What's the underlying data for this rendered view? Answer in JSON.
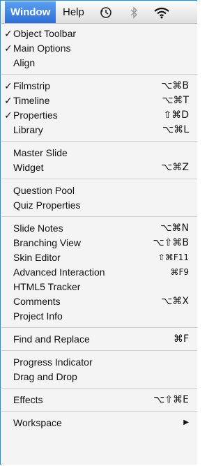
{
  "menubar": {
    "window": "Window",
    "help": "Help"
  },
  "groups": [
    [
      {
        "label": "Object Toolbar",
        "checked": true,
        "shortcut": ""
      },
      {
        "label": "Main Options",
        "checked": true,
        "shortcut": ""
      },
      {
        "label": "Align",
        "checked": false,
        "shortcut": ""
      }
    ],
    [
      {
        "label": "Filmstrip",
        "checked": true,
        "shortcut": "⌥⌘B"
      },
      {
        "label": "Timeline",
        "checked": true,
        "shortcut": "⌥⌘T"
      },
      {
        "label": "Properties",
        "checked": true,
        "shortcut": "⇧⌘D"
      },
      {
        "label": "Library",
        "checked": false,
        "shortcut": "⌥⌘L"
      }
    ],
    [
      {
        "label": "Master Slide",
        "checked": false,
        "shortcut": ""
      },
      {
        "label": "Widget",
        "checked": false,
        "shortcut": "⌥⌘Z"
      }
    ],
    [
      {
        "label": "Question Pool",
        "checked": false,
        "shortcut": ""
      },
      {
        "label": "Quiz Properties",
        "checked": false,
        "shortcut": ""
      }
    ],
    [
      {
        "label": "Slide Notes",
        "checked": false,
        "shortcut": "⌥⌘N"
      },
      {
        "label": "Branching View",
        "checked": false,
        "shortcut": "⌥⇧⌘B"
      },
      {
        "label": "Skin Editor",
        "checked": false,
        "shortcut": "⇧⌘F11"
      },
      {
        "label": "Advanced Interaction",
        "checked": false,
        "shortcut": "⌘F9"
      },
      {
        "label": "HTML5 Tracker",
        "checked": false,
        "shortcut": ""
      },
      {
        "label": "Comments",
        "checked": false,
        "shortcut": "⌥⌘X"
      },
      {
        "label": "Project Info",
        "checked": false,
        "shortcut": ""
      }
    ],
    [
      {
        "label": "Find and Replace",
        "checked": false,
        "shortcut": "⌘F"
      }
    ],
    [
      {
        "label": "Progress Indicator",
        "checked": false,
        "shortcut": ""
      },
      {
        "label": "Drag and Drop",
        "checked": false,
        "shortcut": ""
      }
    ],
    [
      {
        "label": "Effects",
        "checked": false,
        "shortcut": "⌥⇧⌘E"
      }
    ],
    [
      {
        "label": "Workspace",
        "checked": false,
        "shortcut": "",
        "submenu": true
      }
    ]
  ],
  "check_glyph": "✓",
  "submenu_glyph": "▶",
  "icons": [
    "time-machine-icon",
    "bluetooth-icon",
    "wifi-icon"
  ],
  "colors": {
    "highlight": "#2f6fd6",
    "border": "#1e8fe0",
    "menu_bg": "#f4f4f4"
  }
}
